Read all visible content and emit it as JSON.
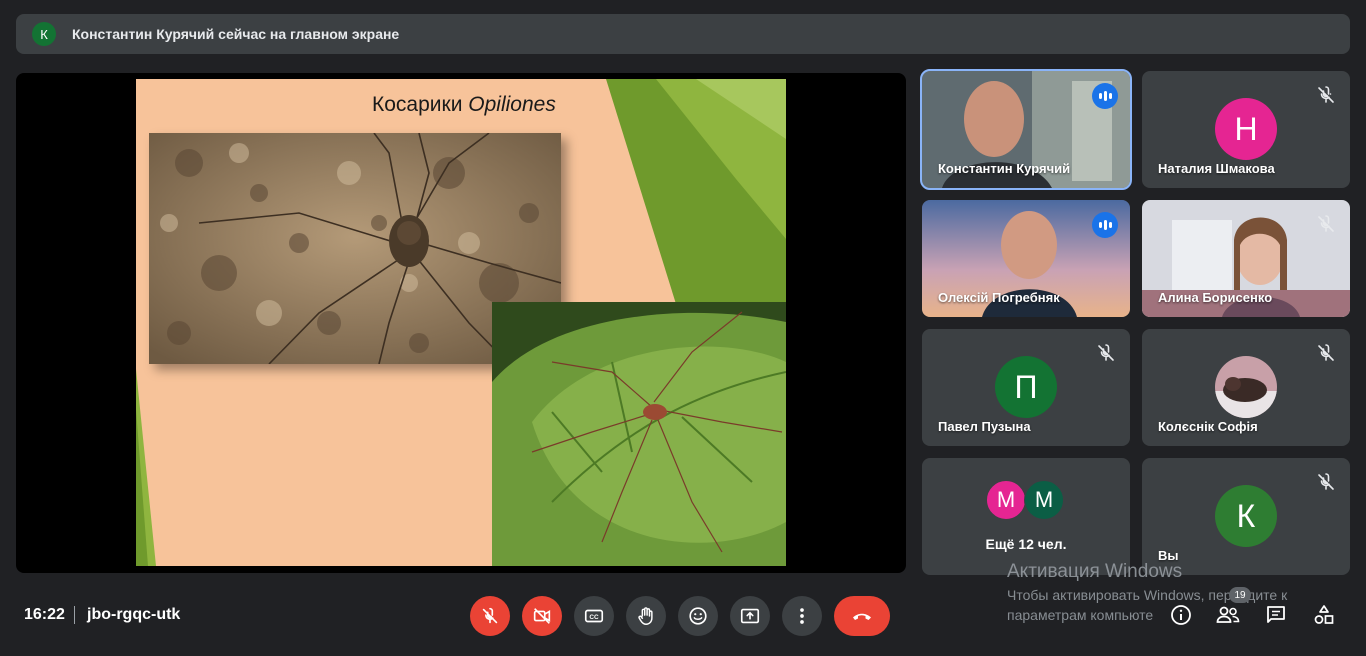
{
  "banner": {
    "avatar_letter": "К",
    "text": "Константин Курячий сейчас на главном экране"
  },
  "presentation": {
    "slide_title_main": "Косарики ",
    "slide_title_italic": "Opiliones"
  },
  "participants": [
    {
      "name": "Константин Курячий",
      "type": "video",
      "speaking": true,
      "active": true
    },
    {
      "name": "Наталия Шмакова",
      "type": "avatar",
      "letter": "Н",
      "color": "#e52592",
      "muted": true
    },
    {
      "name": "Олексій Погребняк",
      "type": "video",
      "speaking": true
    },
    {
      "name": "Алина Борисенко",
      "type": "video",
      "muted": true
    },
    {
      "name": "Павел Пузына",
      "type": "avatar",
      "letter": "П",
      "color": "#137333",
      "muted": true
    },
    {
      "name": "Колєснік Софія",
      "type": "photo-avatar",
      "muted": true
    },
    {
      "name": "Ещё 12 чел.",
      "type": "more",
      "letters": [
        "М",
        "М"
      ],
      "colors": [
        "#e52592",
        "#0b5e45"
      ]
    },
    {
      "name": "Вы",
      "type": "avatar",
      "letter": "К",
      "color": "#2e7d32",
      "muted": true
    }
  ],
  "bottom_bar": {
    "time": "16:22",
    "meeting_code": "jbo-rgqc-utk",
    "participants_count": "19"
  },
  "watermark": {
    "line1": "Активация Windows",
    "line2": "Чтобы активировать Windows, перейдите к",
    "line3": "параметрам компьюте"
  },
  "colors": {
    "background": "#202124",
    "tile": "#3c4043",
    "danger": "#ea4335",
    "accent": "#8ab4f8"
  },
  "icons": [
    "mic-off-icon",
    "camera-off-icon",
    "captions-icon",
    "raise-hand-icon",
    "emoji-icon",
    "present-icon",
    "more-icon",
    "end-call-icon",
    "info-icon",
    "people-icon",
    "chat-icon",
    "activities-icon"
  ]
}
